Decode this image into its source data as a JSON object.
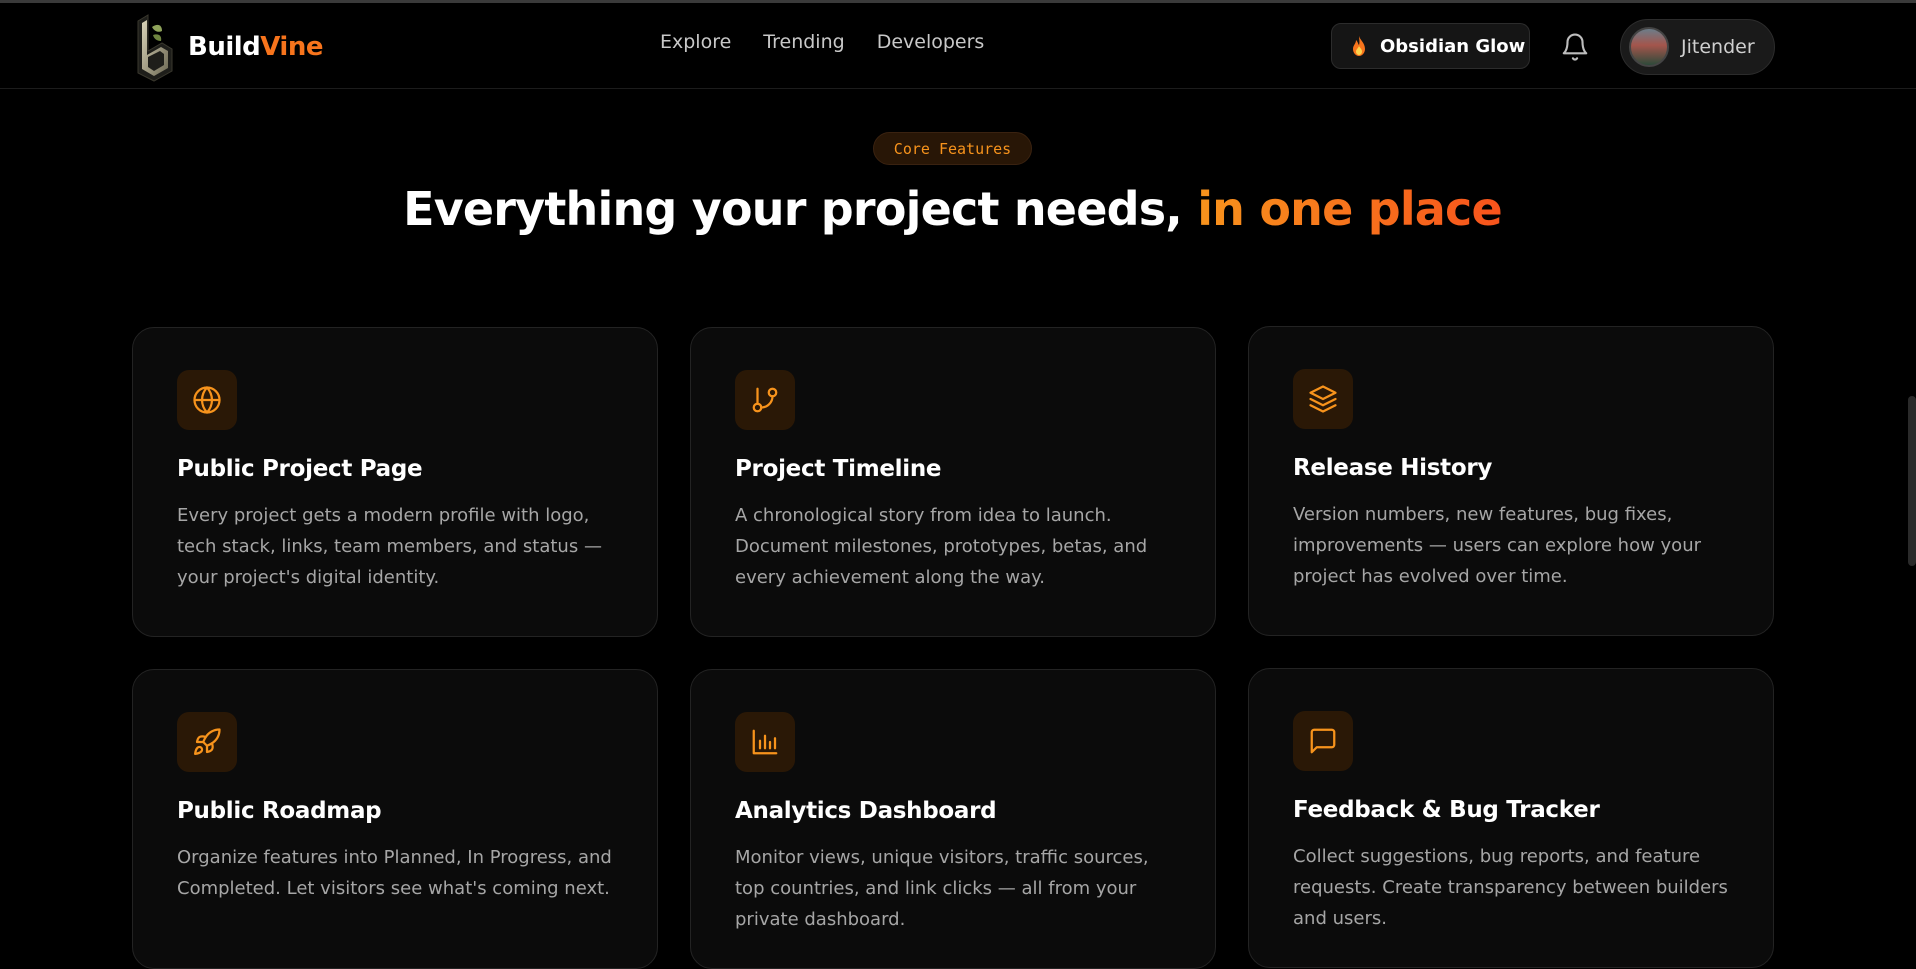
{
  "brand": {
    "name_part1": "Build",
    "name_part2": "Vine",
    "accent_color": "#f7741c"
  },
  "nav": {
    "links": [
      "Explore",
      "Trending",
      "Developers"
    ]
  },
  "header": {
    "theme_label": "Obsidian Glow",
    "theme_icon": "flame-icon",
    "notifications_icon": "bell-icon",
    "user_name": "Jitender"
  },
  "hero": {
    "badge": "Core Features",
    "headline_main": "Everything your project needs, ",
    "headline_accent": "in one place"
  },
  "features": [
    {
      "icon": "globe-icon",
      "title": "Public Project Page",
      "description": "Every project gets a modern profile with logo, tech stack, links, team members, and status — your project's digital identity."
    },
    {
      "icon": "git-branch-icon",
      "title": "Project Timeline",
      "description": "A chronological story from idea to launch. Document milestones, prototypes, betas, and every achievement along the way."
    },
    {
      "icon": "layers-icon",
      "title": "Release History",
      "description": "Version numbers, new features, bug fixes, improvements — users can explore how your project has evolved over time."
    },
    {
      "icon": "rocket-icon",
      "title": "Public Roadmap",
      "description": "Organize features into Planned, In Progress, and Completed. Let visitors see what's coming next."
    },
    {
      "icon": "bar-chart-icon",
      "title": "Analytics Dashboard",
      "description": "Monitor views, unique visitors, traffic sources, top countries, and link clicks — all from your private dashboard."
    },
    {
      "icon": "message-square-icon",
      "title": "Feedback & Bug Tracker",
      "description": "Collect suggestions, bug reports, and feature requests. Create transparency between builders and users."
    }
  ]
}
